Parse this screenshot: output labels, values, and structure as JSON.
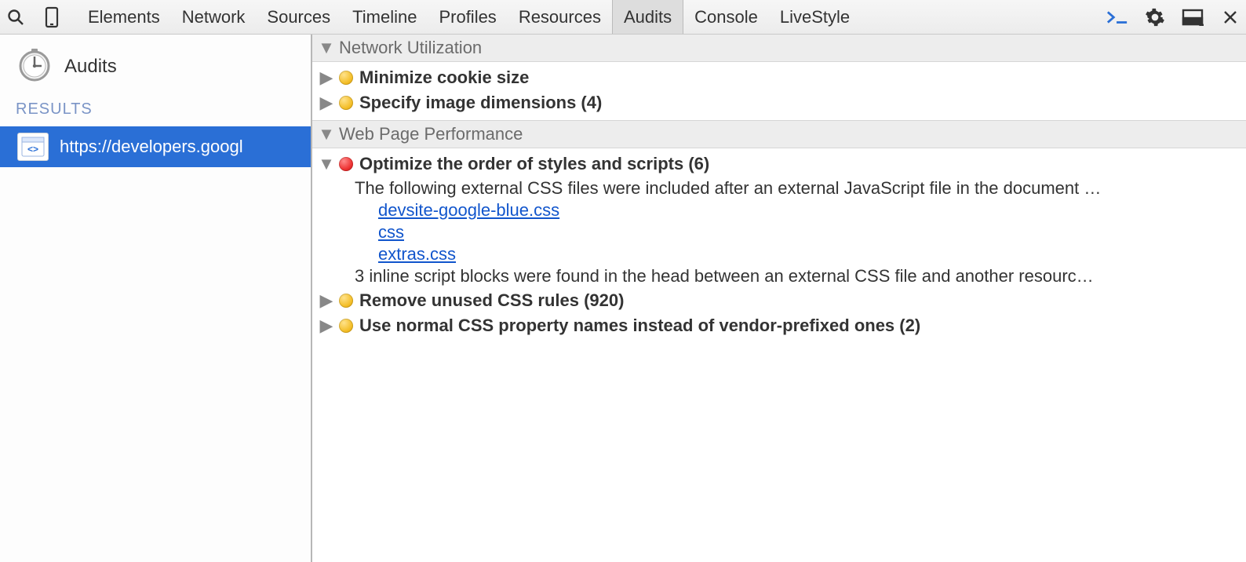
{
  "toolbar": {
    "tabs": [
      {
        "id": "elements",
        "label": "Elements"
      },
      {
        "id": "network",
        "label": "Network"
      },
      {
        "id": "sources",
        "label": "Sources"
      },
      {
        "id": "timeline",
        "label": "Timeline"
      },
      {
        "id": "profiles",
        "label": "Profiles"
      },
      {
        "id": "resources",
        "label": "Resources"
      },
      {
        "id": "audits",
        "label": "Audits"
      },
      {
        "id": "console",
        "label": "Console"
      },
      {
        "id": "livestyle",
        "label": "LiveStyle"
      }
    ],
    "active_tab": "audits"
  },
  "sidebar": {
    "title": "Audits",
    "section_label": "RESULTS",
    "items": [
      {
        "label": "https://developers.googl"
      }
    ]
  },
  "sections": [
    {
      "id": "network-utilization",
      "title": "Network Utilization",
      "expanded": true,
      "rules": [
        {
          "severity": "warn",
          "expanded": false,
          "title": "Minimize cookie size"
        },
        {
          "severity": "warn",
          "expanded": false,
          "title": "Specify image dimensions (4)"
        }
      ]
    },
    {
      "id": "web-page-performance",
      "title": "Web Page Performance",
      "expanded": true,
      "rules": [
        {
          "severity": "err",
          "expanded": true,
          "title": "Optimize the order of styles and scripts (6)",
          "details": {
            "text_before": "The following external CSS files were included after an external JavaScript file in the document …",
            "links": [
              "devsite-google-blue.css",
              "css",
              "extras.css"
            ],
            "text_after": "3 inline script blocks were found in the head between an external CSS file and another resourc…"
          }
        },
        {
          "severity": "warn",
          "expanded": false,
          "title": "Remove unused CSS rules (920)"
        },
        {
          "severity": "warn",
          "expanded": false,
          "title": "Use normal CSS property names instead of vendor-prefixed ones (2)"
        }
      ]
    }
  ]
}
